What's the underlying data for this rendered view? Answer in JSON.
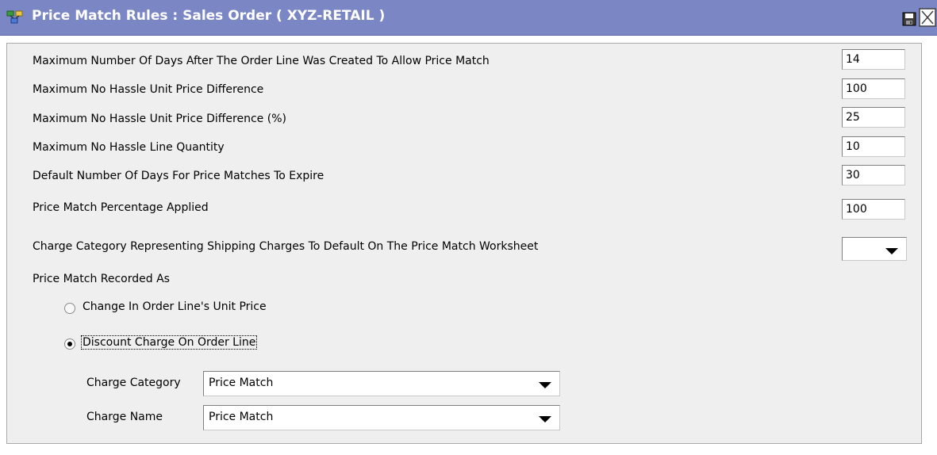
{
  "window": {
    "title": "Price Match Rules : Sales Order ( XYZ-RETAIL )",
    "icons": {
      "app": "price-match-rules-icon",
      "save": "save-icon",
      "close": "close-icon"
    },
    "colors": {
      "titlebar": "#7b86c4",
      "panel": "#efefef"
    }
  },
  "fields": [
    {
      "label": "Maximum Number Of Days After The Order Line Was Created To Allow Price Match",
      "value": "14"
    },
    {
      "label": "Maximum No Hassle Unit Price Difference",
      "value": "100"
    },
    {
      "label": "Maximum No Hassle Unit Price Difference (%)",
      "value": "25"
    },
    {
      "label": "Maximum No Hassle Line Quantity",
      "value": "10"
    },
    {
      "label": "Default Number Of Days For Price Matches To Expire",
      "value": "30"
    },
    {
      "label": "Price Match Percentage Applied",
      "value": "100"
    }
  ],
  "shipping_charge_category": {
    "label": "Charge Category Representing Shipping Charges To Default On The Price Match Worksheet",
    "value": ""
  },
  "recorded_as": {
    "label": "Price Match Recorded As",
    "options": [
      {
        "label": "Change In Order Line's Unit Price",
        "checked": false
      },
      {
        "label": "Discount Charge On Order Line",
        "checked": true
      }
    ]
  },
  "charge": {
    "category_label": "Charge Category",
    "category_value": "Price Match",
    "name_label": "Charge Name",
    "name_value": "Price Match"
  }
}
